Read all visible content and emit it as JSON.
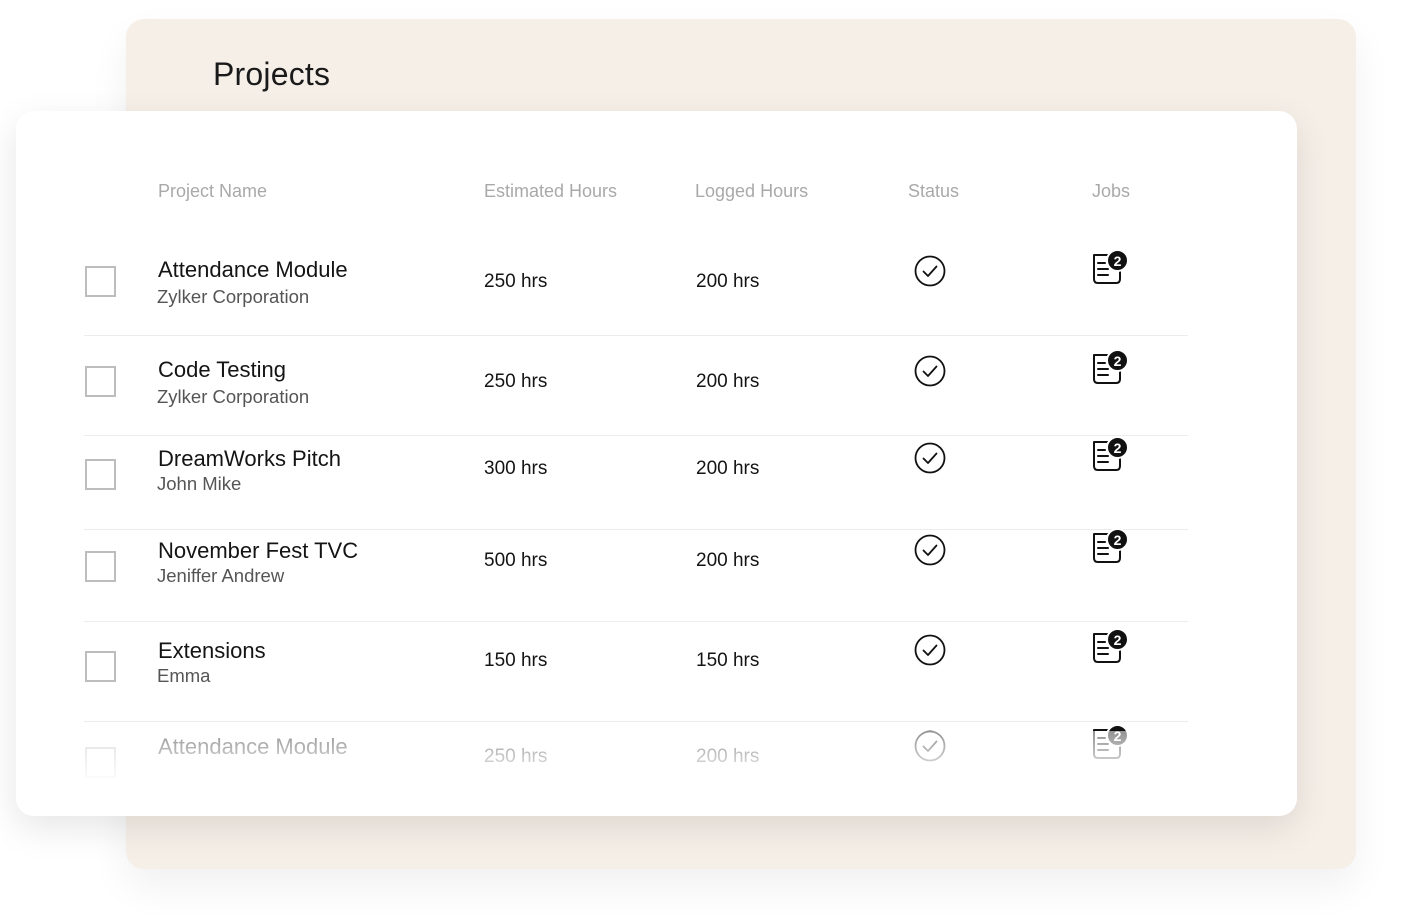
{
  "page": {
    "title": "Projects"
  },
  "table": {
    "headers": {
      "project_name": "Project Name",
      "estimated_hours": "Estimated Hours",
      "logged_hours": "Logged Hours",
      "status": "Status",
      "jobs": "Jobs"
    },
    "rows": [
      {
        "name": "Attendance Module",
        "client": "Zylker Corporation",
        "estimated": "250 hrs",
        "logged": "200 hrs",
        "status_icon": "check-circle-icon",
        "jobs_count": "2"
      },
      {
        "name": "Code Testing",
        "client": "Zylker Corporation",
        "estimated": "250 hrs",
        "logged": "200 hrs",
        "status_icon": "check-circle-icon",
        "jobs_count": "2"
      },
      {
        "name": "DreamWorks Pitch",
        "client": "John Mike",
        "estimated": "300 hrs",
        "logged": "200 hrs",
        "status_icon": "check-circle-icon",
        "jobs_count": "2"
      },
      {
        "name": "November Fest TVC",
        "client": "Jeniffer Andrew",
        "estimated": "500 hrs",
        "logged": "200 hrs",
        "status_icon": "check-circle-icon",
        "jobs_count": "2"
      },
      {
        "name": "Extensions",
        "client": "Emma",
        "estimated": "150 hrs",
        "logged": "150 hrs",
        "status_icon": "check-circle-icon",
        "jobs_count": "2"
      },
      {
        "name": "Attendance Module",
        "client": "",
        "estimated": "250 hrs",
        "logged": "200 hrs",
        "status_icon": "check-circle-icon",
        "jobs_count": "2"
      }
    ]
  },
  "colors": {
    "back_panel": "#f6efe8",
    "card": "#ffffff",
    "header_text": "#a9a9a9",
    "badge": "#111111"
  }
}
